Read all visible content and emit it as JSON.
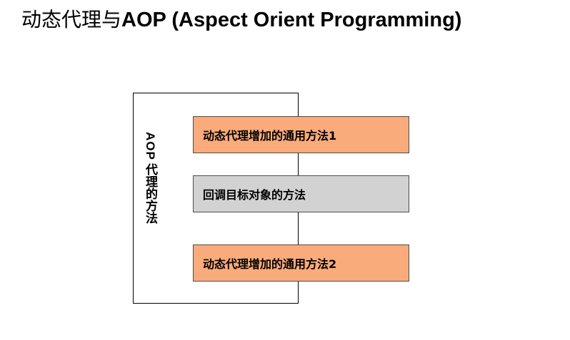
{
  "title": {
    "cn": "动态代理与",
    "en": "AOP (Aspect Orient Programming)"
  },
  "diagram": {
    "container_label_latin": "AOP",
    "container_label_cjk": "代理的方法",
    "steps": [
      {
        "label": "动态代理增加的通用方法1",
        "kind": "advice"
      },
      {
        "label": "回调目标对象的方法",
        "kind": "target"
      },
      {
        "label": "动态代理增加的通用方法2",
        "kind": "advice"
      }
    ]
  },
  "colors": {
    "advice_fill": "#f9ab7b",
    "target_fill": "#d2d2d2"
  }
}
